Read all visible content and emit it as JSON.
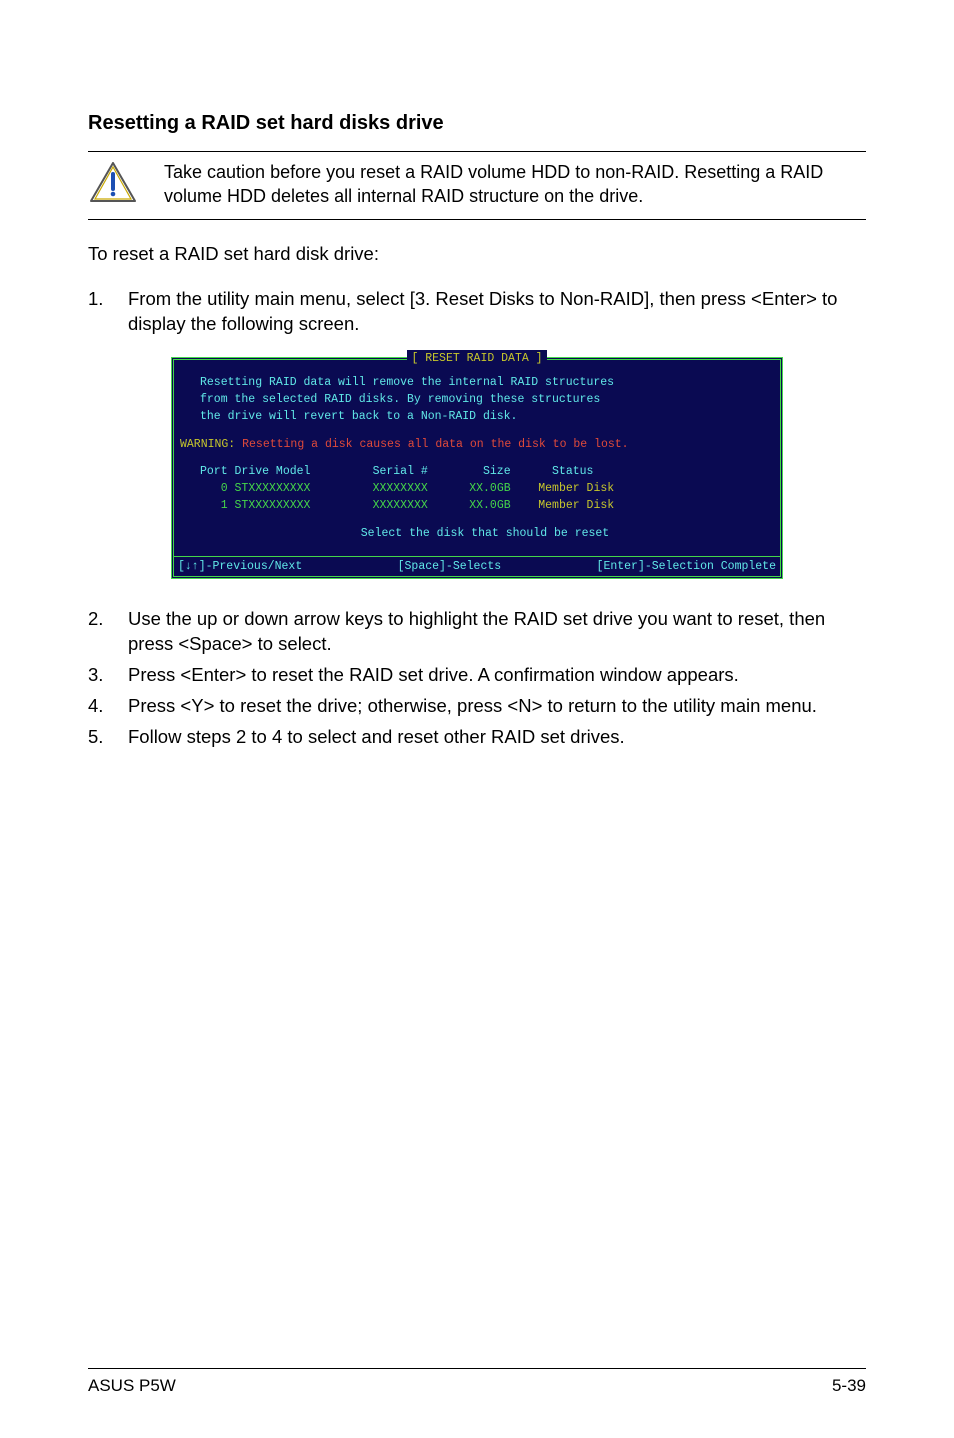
{
  "section_title": "Resetting a RAID set hard disks drive",
  "note_text": "Take caution before you reset a RAID volume HDD to non-RAID. Resetting a RAID volume HDD deletes all internal RAID structure on the drive.",
  "intro": "To reset a RAID set hard disk drive:",
  "steps_before": [
    {
      "num": "1.",
      "text": "From the utility main menu, select [3. Reset Disks to Non-RAID], then press <Enter> to display the following screen."
    }
  ],
  "steps_after": [
    {
      "num": "2.",
      "text": "Use the up or down arrow keys to highlight the RAID set drive you want to reset, then press <Space> to select."
    },
    {
      "num": "3.",
      "text": "Press <Enter> to reset the RAID set drive. A confirmation window appears."
    },
    {
      "num": "4.",
      "text": "Press <Y> to reset the drive; otherwise, press <N> to return to the utility main menu."
    },
    {
      "num": "5.",
      "text": "Follow steps 2 to 4 to select and reset other RAID set drives."
    }
  ],
  "terminal": {
    "title": "[ RESET RAID DATA ]",
    "msg1": "Resetting RAID data will remove the internal RAID structures",
    "msg2": "from the selected RAID disks. By removing these structures",
    "msg3": "the drive will revert back to a Non-RAID disk.",
    "warning_label": "WARNING: ",
    "warning_text": "Resetting a disk causes all data on the disk to be lost.",
    "hdr_port": "Port",
    "hdr_model": "Drive Model",
    "hdr_serial": "Serial #",
    "hdr_size": "Size",
    "hdr_status": "Status",
    "rows": [
      {
        "port": "0",
        "model": "STXXXXXXXXX",
        "serial": "XXXXXXXX",
        "size": "XX.0GB",
        "status": "Member Disk"
      },
      {
        "port": "1",
        "model": "STXXXXXXXXX",
        "serial": "XXXXXXXX",
        "size": "XX.0GB",
        "status": "Member Disk"
      }
    ],
    "prompt": "Select the disk that should be reset",
    "footer_nav": "[↓↑]-Previous/Next",
    "footer_space": "[Space]-Selects",
    "footer_enter": "[Enter]-Selection Complete"
  },
  "footer": {
    "left": "ASUS P5W",
    "right": "5-39"
  }
}
